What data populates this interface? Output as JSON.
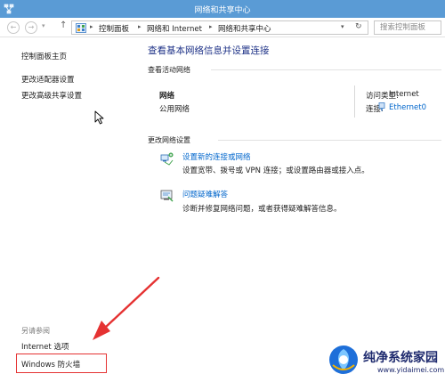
{
  "window": {
    "title": "网络和共享中心"
  },
  "address_bar": {
    "back_icon": "back-arrow-icon",
    "forward_icon": "forward-arrow-icon",
    "up_icon": "up-arrow-icon",
    "breadcrumbs": [
      "控制面板",
      "网络和 Internet",
      "网络和共享中心"
    ],
    "search_placeholder": "搜索控制面板"
  },
  "left_pane": {
    "links": [
      "控制面板主页",
      "更改适配器设置",
      "更改高级共享设置"
    ],
    "see_also": {
      "label": "另请参阅",
      "links": [
        "Internet 选项",
        "Windows 防火墙"
      ]
    }
  },
  "main": {
    "title": "查看基本网络信息并设置连接",
    "active_networks_label": "查看活动网络",
    "network": {
      "name": "网络",
      "type": "公用网络",
      "access_type_label": "访问类型:",
      "access_type_value": "Internet",
      "connections_label": "连接:",
      "connection_link": "Ethernet0"
    },
    "change_settings_label": "更改网络设置",
    "tasks": [
      {
        "icon": "network-setup-icon",
        "link": "设置新的连接或网络",
        "desc": "设置宽带、拨号或 VPN 连接；或设置路由器或接入点。"
      },
      {
        "icon": "troubleshoot-icon",
        "link": "问题疑难解答",
        "desc": "诊断并修复网络问题，或者获得疑难解答信息。"
      }
    ]
  },
  "watermark": {
    "title": "纯净系统家园",
    "url": "www.yidaimei.com"
  },
  "colors": {
    "titlebar": "#5a9bd5",
    "link": "#0066cc",
    "heading": "#1e3287",
    "annotation": "#e53232"
  }
}
